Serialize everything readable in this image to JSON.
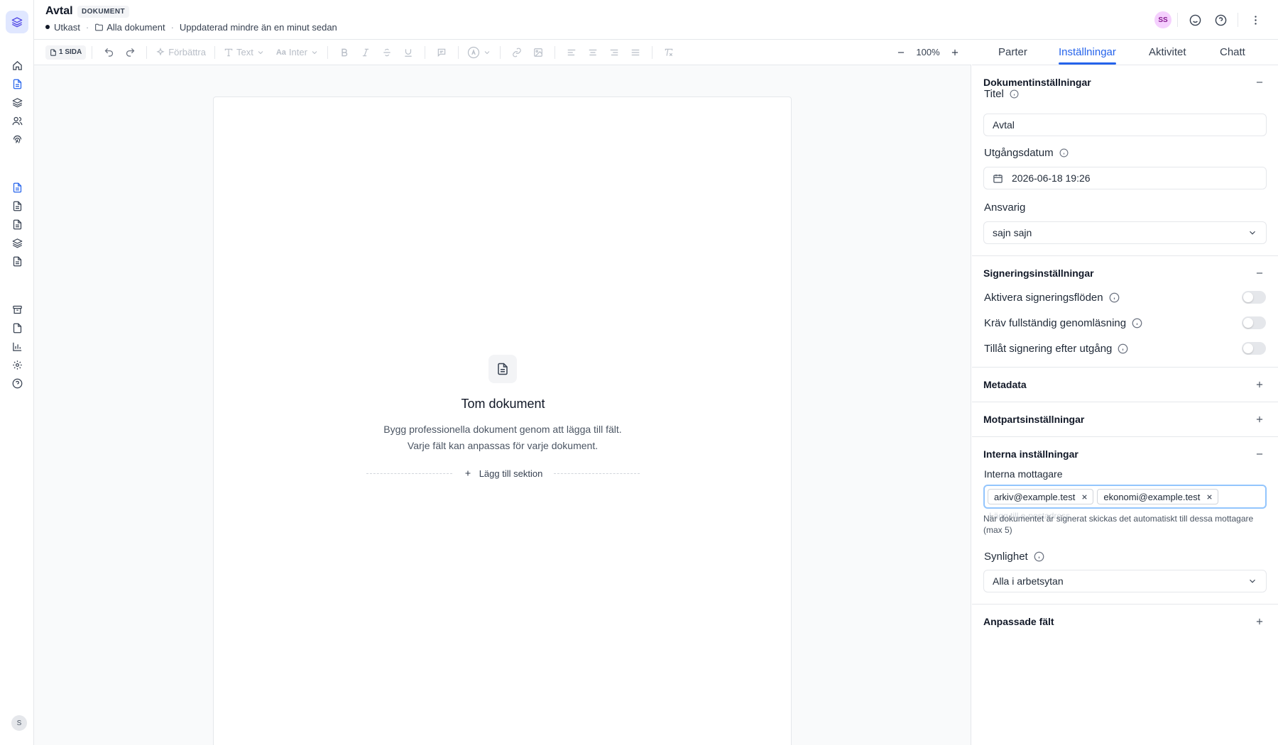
{
  "header": {
    "title": "Avtal",
    "type_tag": "DOKUMENT",
    "status": "Utkast",
    "folder": "Alla dokument",
    "updated": "Uppdaterad mindre än en minut sedan",
    "avatar_initials": "SS",
    "icons": [
      "emoji-icon",
      "help-icon",
      "more-vertical-icon"
    ]
  },
  "sidebar": {
    "user_initial": "S",
    "icons": [
      "home-icon",
      "document-icon",
      "layers-icon",
      "users-icon",
      "fingerprint-icon",
      "document-icon",
      "document-icon",
      "document-icon",
      "layers-icon",
      "document-icon",
      "archive-icon",
      "file-icon",
      "chart-icon",
      "settings-icon",
      "help-icon"
    ],
    "active_item": "document-icon"
  },
  "toolbar": {
    "pages": "1 SIDA",
    "improve": "Förbättra",
    "text_style": "Text",
    "font": "Inter",
    "zoom": "100%"
  },
  "editor": {
    "empty_title": "Tom dokument",
    "empty_description": "Bygg professionella dokument genom att lägga till fält. Varje fält kan anpassas för varje dokument.",
    "add_section": "Lägg till sektion"
  },
  "panel": {
    "tabs": [
      {
        "label": "Parter"
      },
      {
        "label": "Inställningar"
      },
      {
        "label": "Aktivitet"
      },
      {
        "label": "Chatt"
      }
    ],
    "active_tab": "Inställningar",
    "document_settings": {
      "title": "Dokumentinställningar",
      "title_label": "Titel",
      "title_value": "Avtal",
      "expiry_label": "Utgångsdatum",
      "expiry_value": "2026-06-18 19:26",
      "owner_label": "Ansvarig",
      "owner_value": "sajn sajn"
    },
    "signing_settings": {
      "title": "Signeringsinställningar",
      "enable_flows": "Aktivera signeringsflöden",
      "require_read": "Kräv fullständig genomläsning",
      "allow_after_expiry": "Tillåt signering efter utgång",
      "enable_flows_on": false,
      "require_read_on": false,
      "allow_after_expiry_on": false
    },
    "metadata": {
      "title": "Metadata"
    },
    "counterparty": {
      "title": "Motpartsinställningar"
    },
    "internal": {
      "title": "Interna inställningar",
      "recipients_label": "Interna mottagare",
      "recipients": [
        "arkiv@example.test",
        "ekonomi@example.test"
      ],
      "placeholder": "Lägg till e-postadress",
      "help": "När dokumentet är signerat skickas det automatiskt till dessa mottagare (max 5)",
      "visibility_label": "Synlighet",
      "visibility_value": "Alla i arbetsytan"
    },
    "custom_fields": {
      "title": "Anpassade fält"
    }
  }
}
